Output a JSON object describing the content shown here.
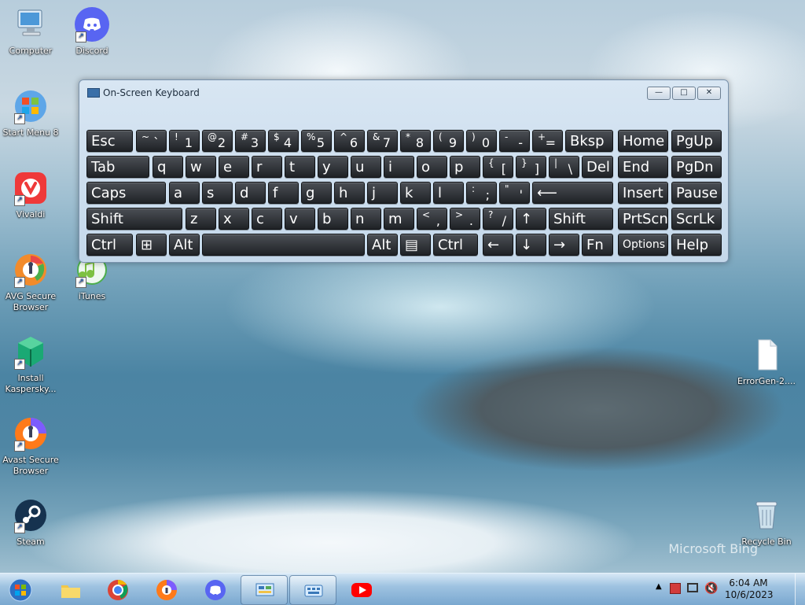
{
  "desktop": {
    "icons": [
      {
        "label": "Computer",
        "shortcut": false
      },
      {
        "label": "Discord",
        "shortcut": true
      },
      {
        "label": "Start Menu 8",
        "shortcut": true
      },
      {
        "label": "Vivaldi",
        "shortcut": true
      },
      {
        "label": "iTunes",
        "shortcut": true
      },
      {
        "label": "AVG Secure Browser",
        "shortcut": true
      },
      {
        "label": "Install Kaspersky...",
        "shortcut": true
      },
      {
        "label": "Avast Secure Browser",
        "shortcut": true
      },
      {
        "label": "Steam",
        "shortcut": true
      },
      {
        "label": "ErrorGen-2....",
        "shortcut": false
      },
      {
        "label": "Recycle Bin",
        "shortcut": false
      }
    ],
    "watermark": "Microsoft Bing"
  },
  "window": {
    "title": "On-Screen Keyboard",
    "buttons": [
      "—",
      "□",
      "✕"
    ]
  },
  "keyboard": {
    "rows": [
      [
        "Esc",
        "~ `",
        "! 1",
        "@ 2",
        "# 3",
        "$ 4",
        "% 5",
        "^ 6",
        "& 7",
        "* 8",
        "( 9",
        ") 0",
        "- -",
        "+ =",
        "Bksp",
        "Home",
        "PgUp"
      ],
      [
        "Tab",
        "q",
        "w",
        "e",
        "r",
        "t",
        "y",
        "u",
        "i",
        "o",
        "p",
        "{ [",
        "} ]",
        "| \\",
        "Del",
        "End",
        "PgDn"
      ],
      [
        "Caps",
        "a",
        "s",
        "d",
        "f",
        "g",
        "h",
        "j",
        "k",
        "l",
        ": ;",
        "\" '",
        "⟵",
        "Insert",
        "Pause"
      ],
      [
        "Shift",
        "z",
        "x",
        "c",
        "v",
        "b",
        "n",
        "m",
        "< ,",
        "> .",
        "? /",
        "↑",
        "Shift",
        "PrtScn",
        "ScrLk"
      ],
      [
        "Ctrl",
        "⊞",
        "Alt",
        "",
        "Alt",
        "▤",
        "Ctrl",
        "←",
        "↓",
        "→",
        "Fn",
        "Options",
        "Help"
      ]
    ]
  },
  "taskbar": {
    "time": "6:04 AM",
    "date": "10/6/2023",
    "tray_arrow": "▲"
  },
  "colors": {
    "taskbar_blue": "#9fc3e1",
    "window_blue": "#c4d8ea",
    "key_dark": "#1f2226",
    "chrome_red": "#db4437",
    "chrome_yellow": "#f4b400",
    "chrome_green": "#0f9d58",
    "discord": "#5865f2",
    "youtube": "#ff0000"
  }
}
